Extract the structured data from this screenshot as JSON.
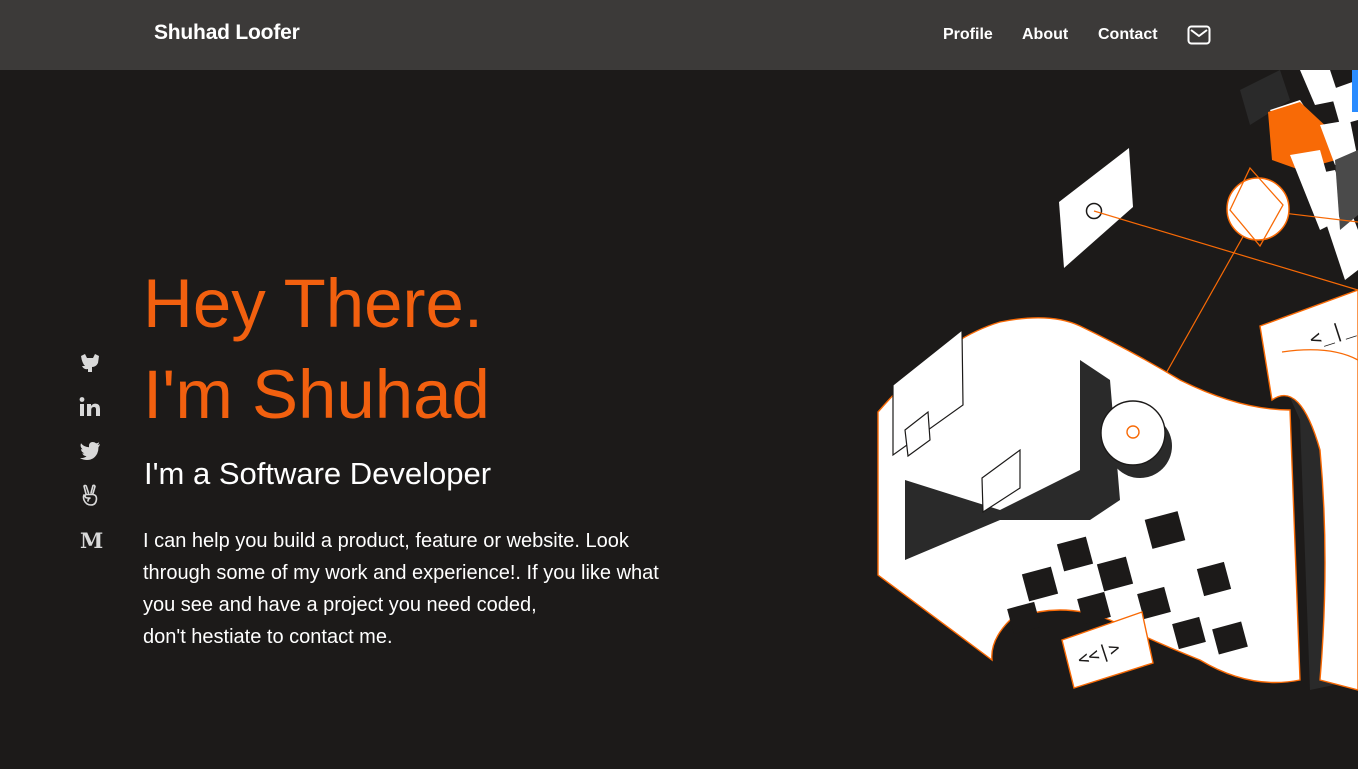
{
  "nav": {
    "brand": "Shuhad Loofer",
    "links": [
      {
        "label": "Profile"
      },
      {
        "label": "About"
      },
      {
        "label": "Contact"
      }
    ],
    "mail_icon": "mail-icon"
  },
  "social": [
    {
      "icon": "github-icon"
    },
    {
      "icon": "linkedin-icon"
    },
    {
      "icon": "twitter-icon"
    },
    {
      "icon": "angellist-icon"
    },
    {
      "icon": "medium-icon"
    }
  ],
  "hero": {
    "line1": "Hey There.",
    "line2": "I'm Shuhad",
    "subtitle": "I'm a Software Developer",
    "paragraph_lines": [
      "I can help you build a product, feature or website. Look",
      "through some of my work and experience!. If you like what",
      "you see and have a project you need coded,",
      "don't hestiate to contact me."
    ]
  },
  "illustration": {
    "code_tag_1": "<_|_",
    "code_tag_2": "<<|>"
  },
  "colors": {
    "background": "#1c1a19",
    "navbar": "#3c3a39",
    "accent": "#f2600f",
    "text": "#ffffff",
    "icon": "#d9d9d9"
  }
}
